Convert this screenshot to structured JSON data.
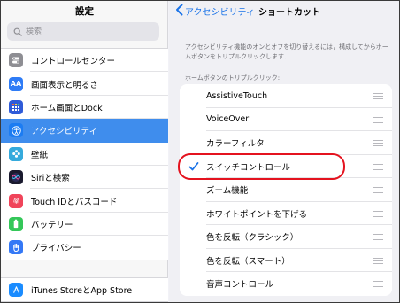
{
  "sidebar": {
    "title": "設定",
    "search_placeholder": "検索",
    "groups": [
      [
        {
          "label": "コントロールセンター",
          "icon": "toggles-icon",
          "color": "#8e8e93"
        },
        {
          "label": "画面表示と明るさ",
          "icon": "text-size-icon",
          "color": "#2f7cf6"
        },
        {
          "label": "ホーム画面とDock",
          "icon": "home-grid-icon",
          "color": "#2f5bd8"
        },
        {
          "label": "アクセシビリティ",
          "icon": "accessibility-icon",
          "color": "#1c7cf2",
          "selected": true
        },
        {
          "label": "壁紙",
          "icon": "wallpaper-flower-icon",
          "color": "#35aadc"
        },
        {
          "label": "Siriと検索",
          "icon": "siri-icon",
          "color": "#1a1a2e"
        },
        {
          "label": "Touch IDとパスコード",
          "icon": "fingerprint-icon",
          "color": "#f0445a"
        },
        {
          "label": "バッテリー",
          "icon": "battery-icon",
          "color": "#34c759"
        },
        {
          "label": "プライバシー",
          "icon": "privacy-hand-icon",
          "color": "#3478f6"
        }
      ],
      [
        {
          "label": "iTunes StoreとApp Store",
          "icon": "app-store-icon",
          "color": "#1a8cff"
        }
      ]
    ]
  },
  "nav": {
    "back_label": "アクセシビリティ",
    "title": "ショートカット"
  },
  "description": "アクセシビリティ機能のオンとオフを切り替えるには，構成してからホームボタンをトリプルクリックします．",
  "section_header": "ホームボタンのトリプルクリック:",
  "options": [
    {
      "label": "AssistiveTouch",
      "checked": false
    },
    {
      "label": "VoiceOver",
      "checked": false
    },
    {
      "label": "カラーフィルタ",
      "checked": false
    },
    {
      "label": "スイッチコントロール",
      "checked": true
    },
    {
      "label": "ズーム機能",
      "checked": false
    },
    {
      "label": "ホワイトポイントを下げる",
      "checked": false
    },
    {
      "label": "色を反転（クラシック）",
      "checked": false
    },
    {
      "label": "色を反転（スマート）",
      "checked": false
    },
    {
      "label": "音声コントロール",
      "checked": false
    }
  ],
  "colors": {
    "accent": "#1a73e8",
    "selection": "#3f8ded",
    "highlight_ring": "#e4131f"
  }
}
